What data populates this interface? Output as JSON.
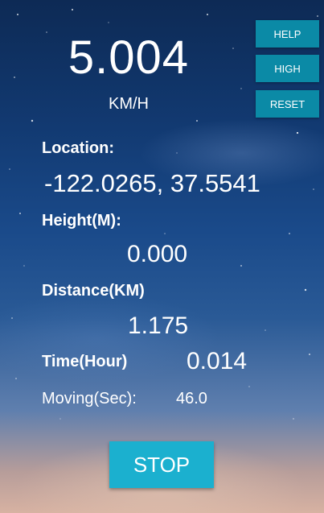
{
  "speed": {
    "value": "5.004",
    "unit": "KM/H"
  },
  "buttons": {
    "help": "HELP",
    "high": "HIGH",
    "reset": "RESET",
    "stop": "STOP"
  },
  "location": {
    "label": "Location:",
    "value": "-122.0265, 37.5541"
  },
  "height": {
    "label": "Height(M):",
    "value": "0.000"
  },
  "distance": {
    "label": "Distance(KM)",
    "value": "1.175"
  },
  "time": {
    "label": "Time(Hour)",
    "value": "0.014"
  },
  "moving": {
    "label": "Moving(Sec):",
    "value": "46.0"
  },
  "colors": {
    "button_bg": "#0b8aa6",
    "stop_bg": "#1bb0cf"
  }
}
